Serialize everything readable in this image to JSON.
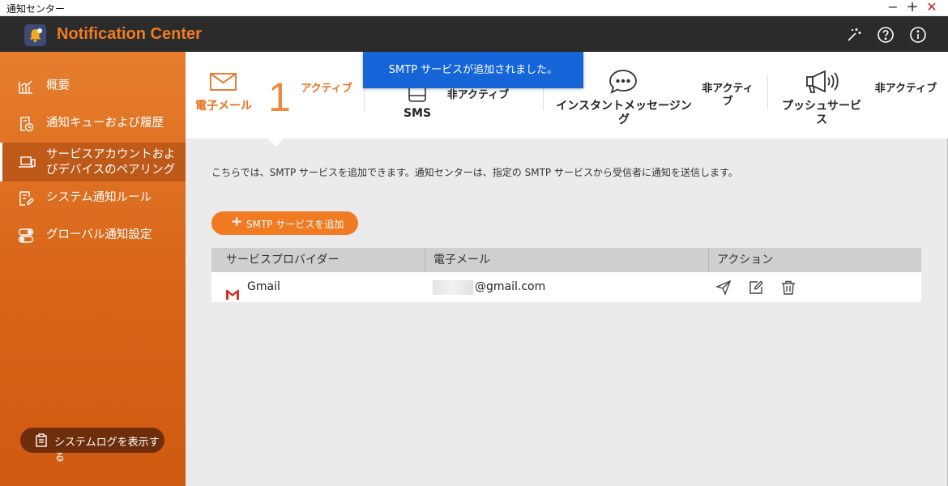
{
  "window": {
    "title": "通知センター",
    "min": "−",
    "max": "+",
    "close": "✕"
  },
  "app": {
    "title": "Notification Center"
  },
  "sidebar": {
    "items": [
      {
        "label": "概要"
      },
      {
        "label": "通知キューおよび履歴"
      },
      {
        "label": "サービスアカウントおよびデバイスのペアリング"
      },
      {
        "label": "システム通知ルール"
      },
      {
        "label": "グローバル通知設定"
      }
    ],
    "syslog_button": "システムログを表示する"
  },
  "tabs": [
    {
      "name": "電子メール",
      "status": "アクティブ",
      "count": "1"
    },
    {
      "name": "SMS",
      "status": "非アクティブ"
    },
    {
      "name": "インスタントメッセージング",
      "status": "非アクティブ"
    },
    {
      "name": "プッシュサービス",
      "status": "非アクティブ"
    }
  ],
  "toast": "SMTP サービスが追加されました。",
  "main": {
    "description": "こちらでは、SMTP サービスを追加できます。通知センターは、指定の SMTP サービスから受信者に通知を送信します。",
    "add_button": "SMTP サービスを追加"
  },
  "table": {
    "headers": [
      "サービスプロバイダー",
      "電子メール",
      "アクション"
    ],
    "rows": [
      {
        "provider": "Gmail",
        "email": "@gmail.com"
      }
    ]
  },
  "colors": {
    "accent": "#f07b22",
    "sidebar": "#d86418",
    "toast": "#1565d8",
    "header": "#2b2b2b"
  }
}
